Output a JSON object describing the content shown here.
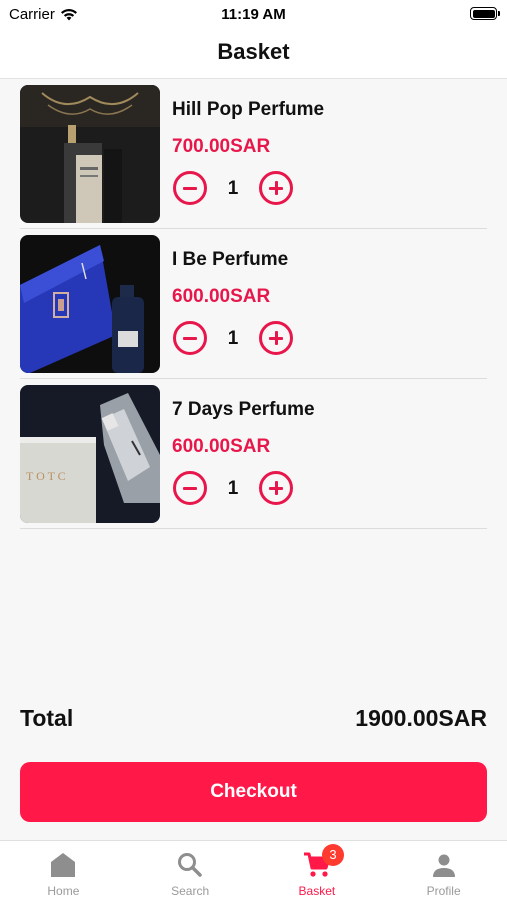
{
  "status_bar": {
    "carrier": "Carrier",
    "time": "11:19 AM"
  },
  "header": {
    "title": "Basket"
  },
  "basket": {
    "items": [
      {
        "name": "Hill Pop Perfume",
        "price": "700.00SAR",
        "quantity": "1"
      },
      {
        "name": "I Be Perfume",
        "price": "600.00SAR",
        "quantity": "1"
      },
      {
        "name": "7 Days Perfume",
        "price": "600.00SAR",
        "quantity": "1"
      }
    ]
  },
  "summary": {
    "total_label": "Total",
    "total_value": "1900.00SAR"
  },
  "checkout": {
    "label": "Checkout"
  },
  "tabbar": {
    "tabs": [
      {
        "label": "Home",
        "icon": "home-icon"
      },
      {
        "label": "Search",
        "icon": "search-icon"
      },
      {
        "label": "Basket",
        "icon": "cart-icon",
        "badge": "3"
      },
      {
        "label": "Profile",
        "icon": "person-icon"
      }
    ],
    "active": "Basket"
  },
  "colors": {
    "accent": "#ff1848",
    "price": "#e8174b",
    "badge": "#ff3a2e"
  }
}
